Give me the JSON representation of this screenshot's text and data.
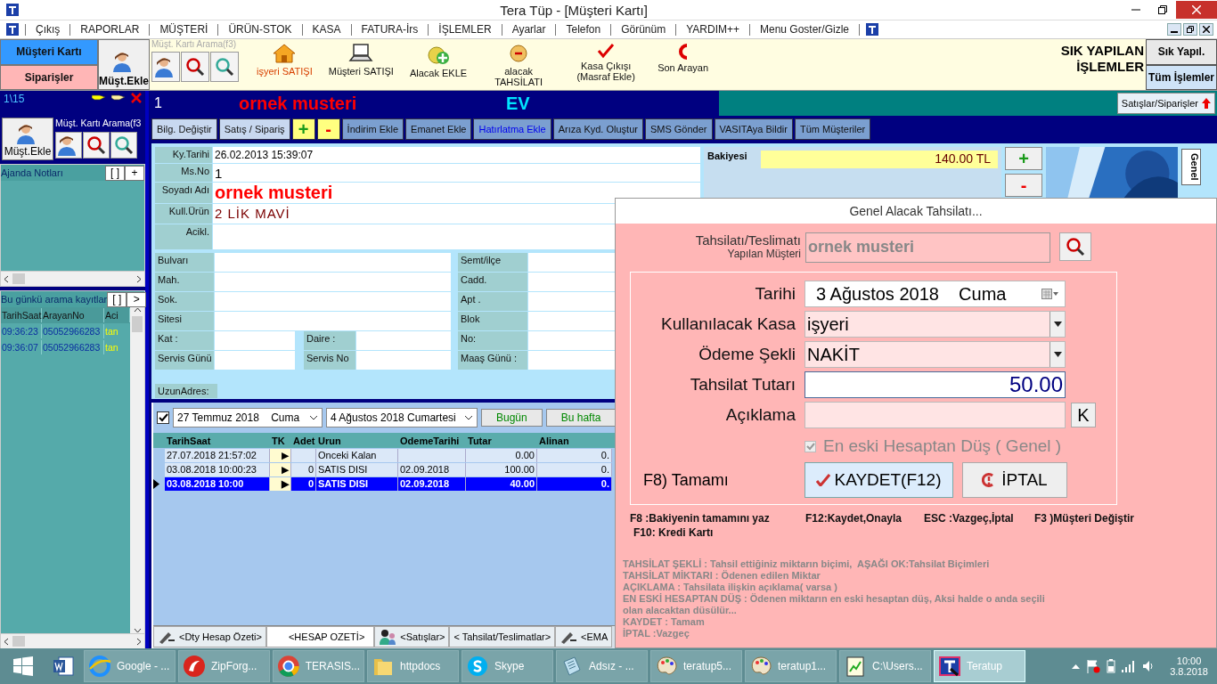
{
  "window": {
    "title": "Tera Tüp - [Müşteri Kartı]"
  },
  "menu": [
    "Çıkış",
    "RAPORLAR",
    "MÜŞTERİ",
    "ÜRÜN-STOK",
    "KASA",
    "FATURA-İrs",
    "İŞLEMLER",
    "Ayarlar",
    "Telefon",
    "Görünüm",
    "YARDIM++",
    "Menu Goster/Gizle"
  ],
  "toolbar": {
    "nav": [
      {
        "label": "Müşteri Kartı",
        "selected": true
      },
      {
        "label": "Siparişler",
        "selected": false
      }
    ],
    "add_customer": "Müşt.Ekle",
    "search_label": "Müşt. Kartı Arama(f3)",
    "tools": [
      {
        "label": "işyeri SATIŞI",
        "kind": "house",
        "highlighted": true
      },
      {
        "label": "Müşteri SATIŞI",
        "kind": "laptop",
        "highlighted": false
      },
      {
        "label": "Alacak EKLE",
        "kind": "coin-plus",
        "highlighted": false
      },
      {
        "label": "alacak TAHSİLATI",
        "kind": "coin",
        "highlighted": false
      },
      {
        "label": "Kasa Çıkışı (Masraf Ekle)",
        "kind": "check",
        "highlighted": false
      },
      {
        "label": "Son Arayan",
        "kind": "arc",
        "highlighted": false
      }
    ],
    "quick_title": "SIK YAPILAN İŞLEMLER",
    "quick_buttons": [
      "Sık Yapıl.",
      "Tüm İşlemler"
    ]
  },
  "left_panel": {
    "counter": "1\\15",
    "add_customer": "Müşt.Ekle",
    "search_label": "Müşt. Kartı Arama(f3",
    "agenda": {
      "title": "Ajanda Notları",
      "buttons": [
        "[ ]",
        "+"
      ]
    },
    "calls": {
      "title": "Bu günkü arama kayıtlar",
      "buttons": [
        "[ ]",
        ">"
      ],
      "columns": [
        "TarihSaat",
        "ArayanNo",
        "Aci"
      ],
      "rows": [
        [
          "09:36:23",
          "05052966283",
          "tan"
        ],
        [
          "09:36:07",
          "05052966283",
          "tan"
        ]
      ]
    }
  },
  "customer_header": {
    "number": "1",
    "name": "ornek musteri",
    "type": "EV",
    "orders_button": "Satışlar/Siparişler"
  },
  "actions": [
    {
      "label": "Bilg. Değiştir",
      "kind": "light"
    },
    {
      "label": "Satış / Sipariş",
      "kind": "light"
    },
    {
      "label": "+",
      "kind": "plus"
    },
    {
      "label": "-",
      "kind": "minus"
    },
    {
      "label": "İndirim Ekle",
      "kind": "plain"
    },
    {
      "label": "Emanet Ekle",
      "kind": "plain"
    },
    {
      "label": "Hatırlatma Ekle",
      "kind": "link"
    },
    {
      "label": "Arıza Kyd. Oluştur",
      "kind": "plain"
    },
    {
      "label": "SMS Gönder",
      "kind": "plain"
    },
    {
      "label": "VASITAya Bildir",
      "kind": "plain"
    },
    {
      "label": "Tüm Müşteriler",
      "kind": "plain"
    }
  ],
  "card": [
    {
      "label": "Ky.Tarihi",
      "value": "26.02.2013 15:39:07",
      "kind": "plain"
    },
    {
      "label": "Ms.No",
      "value": "1",
      "kind": "large"
    },
    {
      "label": "Soyadı Adı",
      "value": "ornek musteri",
      "kind": "name"
    },
    {
      "label": "Kull.Ürün",
      "value": "2 LİK MAVİ",
      "kind": "product"
    },
    {
      "label": "Acikl.",
      "kind": "note"
    }
  ],
  "address": [
    [
      "Bulvarı",
      "Semt/ilçe"
    ],
    [
      "Mah.",
      "Cadd."
    ],
    [
      "Sok.",
      "Apt ."
    ],
    [
      "Sitesi",
      "Blok"
    ],
    [
      "Kat :",
      "Daire :",
      "No:"
    ],
    [
      "Servis Günü",
      "Servis No",
      "Maaş Günü :"
    ]
  ],
  "long_address_label": "UzunAdres:",
  "balance": {
    "label": "Bakiyesi",
    "value": "140.00 TL",
    "buttons": [
      "+",
      "-"
    ],
    "side_tab": "Genel"
  },
  "ledger": {
    "filter": {
      "enabled": true,
      "from": "27 Temmuz 2018    Cuma",
      "to": "4 Ağustos 2018 Cumartesi",
      "buttons": [
        "Bugün",
        "Bu hafta"
      ]
    },
    "columns": [
      "TarihSaat",
      "TK",
      "Adet",
      "Urun",
      "OdemeTarihi",
      "Tutar",
      "Alinan"
    ],
    "rows": [
      {
        "cells": [
          "27.07.2018 21:57:02",
          "▶",
          "",
          "Onceki Kalan",
          "",
          "0.00",
          "0."
        ],
        "selected": false
      },
      {
        "cells": [
          "03.08.2018 10:00:23",
          "▶",
          "0",
          "SATIS DISI",
          "02.09.2018",
          "100.00",
          "0."
        ],
        "selected": false
      },
      {
        "cells": [
          "03.08.2018 10:00",
          "▶",
          "0",
          "SATIS DISI",
          "02.09.2018",
          "40.00",
          "0."
        ],
        "selected": true
      }
    ],
    "tabs": [
      {
        "label": "<Dty Hesap Özeti>",
        "kind": "edit",
        "selected": false
      },
      {
        "label": "<HESAP OZETİ>",
        "kind": "plain",
        "selected": true
      },
      {
        "label": "<Satışlar>",
        "kind": "people",
        "selected": false
      },
      {
        "label": "< Tahsilat/Teslimatlar>",
        "kind": "plain",
        "selected": false
      },
      {
        "label": "<EMA",
        "kind": "edit",
        "selected": false
      }
    ]
  },
  "dialog": {
    "title": "Genel Alacak Tahsilatı...",
    "customer_label": [
      "Tahsilatı/Teslimatı",
      "Yapılan Müşteri"
    ],
    "customer": "ornek musteri",
    "fields": [
      {
        "label": "Tarihi",
        "value": "3 Ağustos 2018    Cuma",
        "kind": "date"
      },
      {
        "label": "Kullanılacak Kasa",
        "value": "işyeri",
        "kind": "select"
      },
      {
        "label": "Ödeme Şekli",
        "value": "NAKİT",
        "kind": "select"
      },
      {
        "label": "Tahsilat Tutarı",
        "value": "50.00",
        "kind": "amount"
      },
      {
        "label": "Açıklama",
        "kind": "text",
        "button": "K"
      }
    ],
    "checkbox": {
      "label": "En eski Hesaptan Düş ( Genel )",
      "checked": true,
      "disabled": true
    },
    "all_label": "F8) Tamamı",
    "save": "KAYDET(F12)",
    "cancel": "İPTAL",
    "shortcuts": [
      "F8 :Bakiyenin tamamını yaz",
      "F12:Kaydet,Onayla",
      "ESC :Vazgeç,İptal",
      "F3 )Müşteri Değiştir",
      "F10: Kredi Kartı"
    ],
    "help": [
      "TAHSİLAT ŞEKLİ : Tahsil ettiğiniz miktarın biçimi,  AŞAĞI OK:Tahsilat Biçimleri",
      "TAHSİLAT MİKTARI : Ödenen edilen Miktar",
      "AÇIKLAMA : Tahsilata ilişkin açıklama( varsa )",
      "EN ESKİ HESAPTAN DÜŞ : Ödenen miktarın en eski hesaptan düş, Aksi halde o anda seçili",
      "olan alacaktan düsülür...",
      "KAYDET : Tamam",
      "İPTAL :Vazgeç"
    ]
  },
  "taskbar": {
    "items": [
      {
        "label": "Google - ...",
        "kind": "globe",
        "selected": false
      },
      {
        "label": "ZipForg...",
        "kind": "red",
        "selected": false
      },
      {
        "label": "TERASIS...",
        "kind": "wheel",
        "selected": false
      },
      {
        "label": "httpdocs",
        "kind": "folder",
        "selected": false
      },
      {
        "label": "Skype",
        "kind": "skype",
        "selected": false
      },
      {
        "label": "Adsız - ...",
        "kind": "notepad",
        "selected": false
      },
      {
        "label": "teratup5...",
        "kind": "palette",
        "selected": false
      },
      {
        "label": "teratup1...",
        "kind": "palette",
        "selected": false
      },
      {
        "label": "C:\\Users...",
        "kind": "console",
        "selected": false
      },
      {
        "label": "Teratup",
        "kind": "app",
        "selected": true
      }
    ],
    "time": "10:00",
    "date": "3.8.2018"
  }
}
